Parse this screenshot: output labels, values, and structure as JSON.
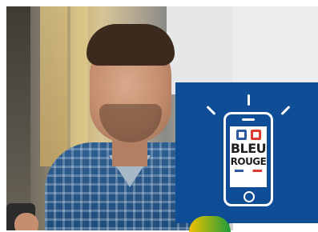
{
  "promo": {
    "logo": {
      "word1": "BLEU",
      "word2": "ROUGE",
      "colors": {
        "blue": "#2c5aa0",
        "red": "#e03a2f"
      }
    },
    "panel_colors": {
      "blue": "#0f4d96",
      "light": "#ebeced"
    },
    "icons": [
      "smartphone-icon",
      "notification-rays-icon"
    ]
  }
}
